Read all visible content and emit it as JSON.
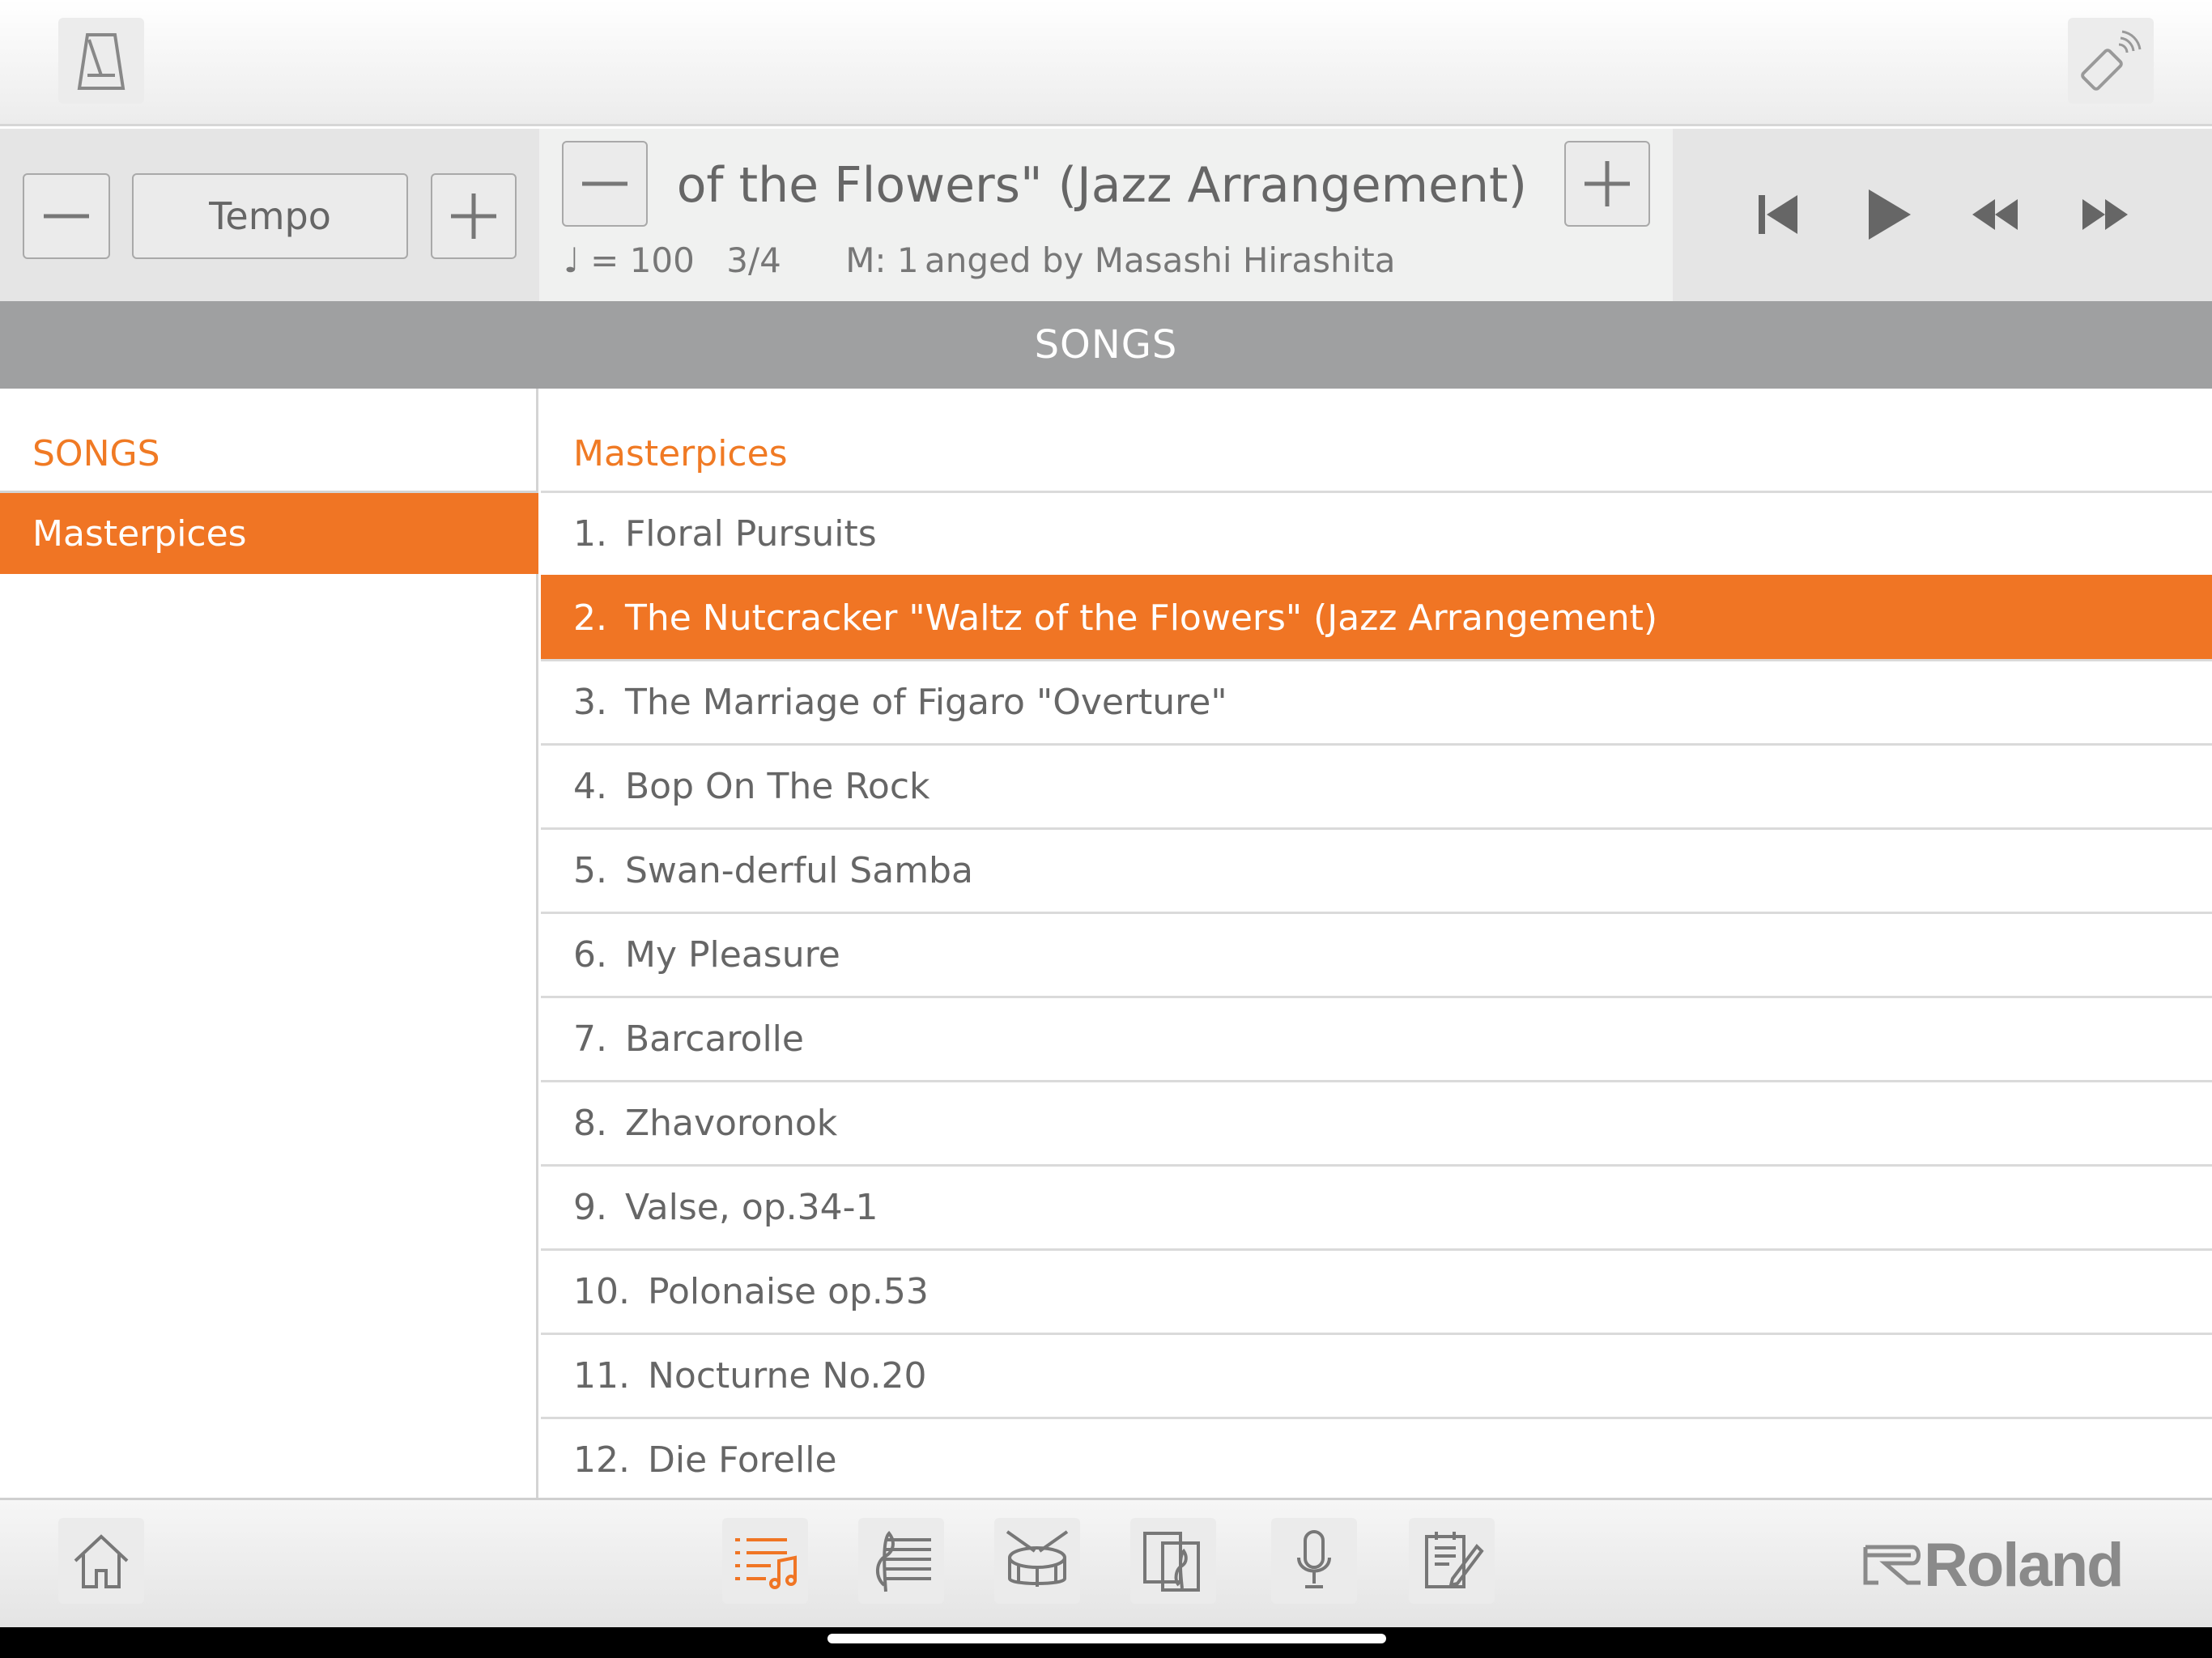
{
  "top_bar": {
    "metronome_icon": "metronome-icon",
    "bluetooth_icon": "bluetooth-device-icon"
  },
  "tempo": {
    "label": "Tempo",
    "minus_icon": "minus-icon",
    "plus_icon": "plus-icon"
  },
  "song_display": {
    "title": "The Nutcracker \"Waltz of the Flowers\" (Jazz Arrangement)",
    "visible_title": "tz of the Flowers\" (Jazz Arrangement)",
    "tempo_value": "♩ = 100",
    "time_signature": "3/4",
    "measure": "M: 1",
    "composer": "anged by Masashi Hirashita"
  },
  "transport": {
    "icons": [
      "skip-to-start-icon",
      "play-icon",
      "rewind-icon",
      "fast-forward-icon"
    ]
  },
  "section_header": "SONGS",
  "categories": {
    "heading": "SONGS",
    "items": [
      {
        "label": "Masterpices",
        "selected": true
      }
    ]
  },
  "song_list": {
    "heading": "Masterpices",
    "items": [
      {
        "num": "1.",
        "title": "Floral Pursuits",
        "selected": false
      },
      {
        "num": "2.",
        "title": "The Nutcracker \"Waltz of the Flowers\" (Jazz Arrangement)",
        "selected": true
      },
      {
        "num": "3.",
        "title": "The Marriage of Figaro \"Overture\"",
        "selected": false
      },
      {
        "num": "4.",
        "title": "Bop On The Rock",
        "selected": false
      },
      {
        "num": "5.",
        "title": "Swan-derful Samba",
        "selected": false
      },
      {
        "num": "6.",
        "title": "My Pleasure",
        "selected": false
      },
      {
        "num": "7.",
        "title": "Barcarolle",
        "selected": false
      },
      {
        "num": "8.",
        "title": "Zhavoronok",
        "selected": false
      },
      {
        "num": "9.",
        "title": "Valse, op.34-1",
        "selected": false
      },
      {
        "num": "10.",
        "title": "Polonaise op.53",
        "selected": false
      },
      {
        "num": "11.",
        "title": "Nocturne No.20",
        "selected": false
      },
      {
        "num": "12.",
        "title": "Die Forelle",
        "selected": false
      }
    ]
  },
  "bottom_nav": {
    "items": [
      "home-icon",
      "song-list-icon",
      "score-icon",
      "drum-icon",
      "sheet-music-icon",
      "microphone-icon",
      "notepad-icon"
    ],
    "active": "song-list-icon",
    "brand": "Roland"
  },
  "colors": {
    "accent": "#f07524",
    "header_gray": "#9fa0a1",
    "text_gray": "#666666"
  }
}
